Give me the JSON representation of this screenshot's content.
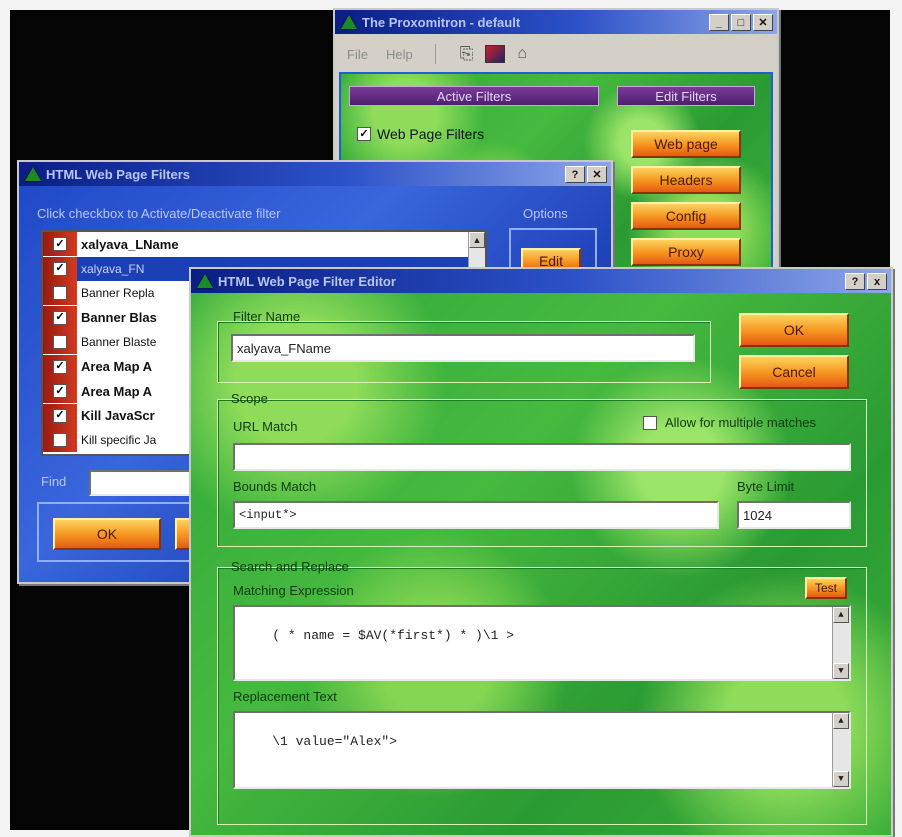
{
  "main_window": {
    "title": "The Proxomitron - default",
    "menu": [
      "File",
      "Help"
    ],
    "active_filters_header": "Active Filters",
    "edit_filters_header": "Edit Filters",
    "web_page_filters_label": "Web Page Filters",
    "buttons": [
      "Web page",
      "Headers",
      "Config",
      "Proxy"
    ]
  },
  "filters_window": {
    "title": "HTML Web Page Filters",
    "instruction": "Click checkbox to Activate/Deactivate filter",
    "options_label": "Options",
    "edit_label": "Edit",
    "find_label": "Find",
    "ok_label": "OK",
    "items": [
      {
        "label": "xalyava_LName",
        "checked": true,
        "bold": true,
        "selected": false
      },
      {
        "label": "xalyava_FN",
        "checked": true,
        "bold": false,
        "selected": true
      },
      {
        "label": "Banner Repla",
        "checked": false,
        "bold": false,
        "selected": false
      },
      {
        "label": "Banner Blas",
        "checked": true,
        "bold": true,
        "selected": false
      },
      {
        "label": "Banner Blaste",
        "checked": false,
        "bold": false,
        "selected": false
      },
      {
        "label": "Area Map A",
        "checked": true,
        "bold": true,
        "selected": false
      },
      {
        "label": "Area Map A",
        "checked": true,
        "bold": true,
        "selected": false
      },
      {
        "label": "Kill JavaScr",
        "checked": true,
        "bold": true,
        "selected": false
      },
      {
        "label": "Kill specific Ja",
        "checked": false,
        "bold": false,
        "selected": false
      }
    ]
  },
  "editor_window": {
    "title": "HTML Web Page Filter Editor",
    "help": "?",
    "close": "x",
    "filter_name_label": "Filter Name",
    "filter_name_value": "xalyava_FName",
    "ok_label": "OK",
    "cancel_label": "Cancel",
    "scope_label": "Scope",
    "url_match_label": "URL Match",
    "url_match_value": "",
    "allow_multiple_label": "Allow for multiple matches",
    "bounds_match_label": "Bounds Match",
    "bounds_match_value": "<input*>",
    "byte_limit_label": "Byte Limit",
    "byte_limit_value": "1024",
    "search_replace_label": "Search and Replace",
    "matching_expression_label": "Matching Expression",
    "test_label": "Test",
    "matching_expression_value": "( * name = $AV(*first*) * )\\1 >",
    "replacement_text_label": "Replacement Text",
    "replacement_text_value": "\\1 value=\"Alex\">"
  }
}
